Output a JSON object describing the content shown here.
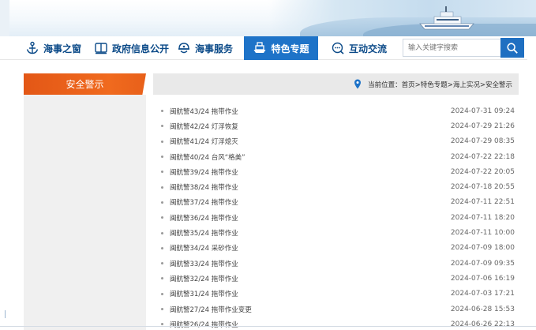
{
  "nav": {
    "items": [
      {
        "label": "海事之窗",
        "icon": "anchor-icon"
      },
      {
        "label": "政府信息公开",
        "icon": "book-icon"
      },
      {
        "label": "海事服务",
        "icon": "helmet-icon"
      },
      {
        "label": "特色专题",
        "icon": "ship-icon",
        "active": true
      },
      {
        "label": "互动交流",
        "icon": "chat-icon"
      }
    ],
    "search_placeholder": "输入关键字搜索"
  },
  "sidebar": {
    "title": "安全警示"
  },
  "breadcrumb": {
    "text": "当前位置：首页>特色专题>海上实况>安全警示"
  },
  "articles": [
    {
      "title": "闽航警43/24 拖带作业",
      "date": "2024-07-31 09:24"
    },
    {
      "title": "闽航警42/24 灯浮恢复",
      "date": "2024-07-29 21:26"
    },
    {
      "title": "闽航警41/24 灯浮熄灭",
      "date": "2024-07-29 08:35"
    },
    {
      "title": "闽航警40/24 台风“格美”",
      "date": "2024-07-22 22:18"
    },
    {
      "title": "闽航警39/24 拖带作业",
      "date": "2024-07-22 20:05"
    },
    {
      "title": "闽航警38/24 拖带作业",
      "date": "2024-07-18 20:55"
    },
    {
      "title": "闽航警37/24 拖带作业",
      "date": "2024-07-11 22:51"
    },
    {
      "title": "闽航警36/24 拖带作业",
      "date": "2024-07-11 18:20"
    },
    {
      "title": "闽航警35/24 拖带作业",
      "date": "2024-07-11 10:00"
    },
    {
      "title": "闽航警34/24 采砂作业",
      "date": "2024-07-09 18:00"
    },
    {
      "title": "闽航警33/24 拖带作业",
      "date": "2024-07-09 09:35"
    },
    {
      "title": "闽航警32/24 拖带作业",
      "date": "2024-07-06 16:19"
    },
    {
      "title": "闽航警31/24 拖带作业",
      "date": "2024-07-03 17:21"
    },
    {
      "title": "闽航警27/24 拖带作业变更",
      "date": "2024-06-28 15:53"
    },
    {
      "title": "闽航警26/24 拖带作业",
      "date": "2024-06-26 22:13"
    }
  ],
  "colors": {
    "nav_text": "#0b4a88",
    "nav_active": "#1e73c8",
    "sidebar_head": "#e35716"
  }
}
